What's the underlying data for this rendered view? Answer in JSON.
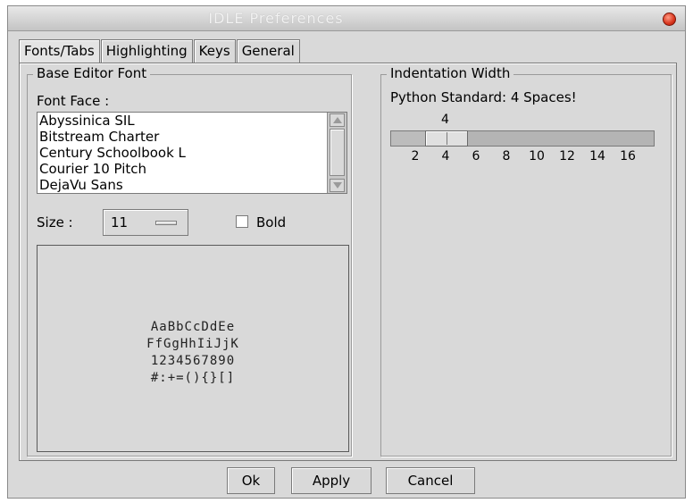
{
  "window": {
    "title": "IDLE Preferences"
  },
  "tabs": [
    {
      "label": "Fonts/Tabs",
      "active": true
    },
    {
      "label": "Highlighting",
      "active": false
    },
    {
      "label": "Keys",
      "active": false
    },
    {
      "label": "General",
      "active": false
    }
  ],
  "font_group": {
    "title": "Base Editor Font",
    "face_label": "Font Face :",
    "fonts": [
      "Abyssinica SIL",
      "Bitstream Charter",
      "Century Schoolbook L",
      "Courier 10 Pitch",
      "DejaVu Sans"
    ],
    "size_label": "Size :",
    "size_value": "11",
    "bold_label": "Bold",
    "bold_checked": false,
    "sample": [
      "AaBbCcDdEe",
      "FfGgHhIiJjK",
      "1234567890",
      "#:+=(){}[]"
    ]
  },
  "indent_group": {
    "title": "Indentation Width",
    "note": "Python Standard: 4 Spaces!",
    "value": 4,
    "min": 2,
    "max": 16,
    "ticks": [
      "2",
      "4",
      "6",
      "8",
      "10",
      "12",
      "14",
      "16"
    ]
  },
  "buttons": {
    "ok": "Ok",
    "apply": "Apply",
    "cancel": "Cancel"
  }
}
